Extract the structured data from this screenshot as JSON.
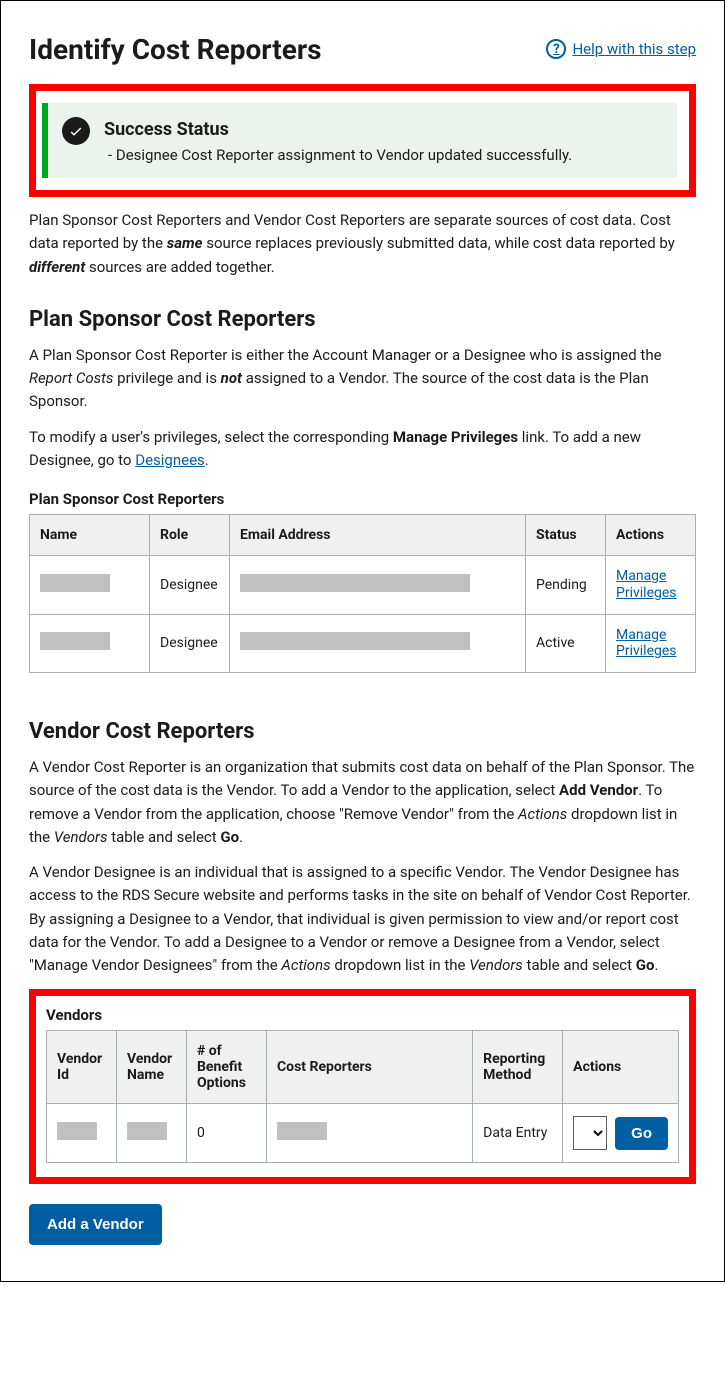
{
  "header": {
    "title": "Identify Cost Reporters",
    "help_label": " Help with this step"
  },
  "alert": {
    "title": "Success Status",
    "message": "Designee Cost Reporter assignment to Vendor updated successfully."
  },
  "intro": {
    "p1a": "Plan Sponsor Cost Reporters and Vendor Cost Reporters are separate sources of cost data. Cost data reported by the ",
    "p1b": "same",
    "p1c": " source replaces previously submitted data, while cost data reported by ",
    "p1d": "different",
    "p1e": " sources are added together."
  },
  "plan_sponsor": {
    "heading": "Plan Sponsor Cost Reporters",
    "p1a": "A Plan Sponsor Cost Reporter is either the Account Manager or a Designee who is assigned the ",
    "p1b": "Report Costs",
    "p1c": " privilege and is ",
    "p1d": "not",
    "p1e": " assigned to a Vendor. The source of the cost data is the Plan Sponsor.",
    "p2a": "To modify a user's privileges, select the corresponding ",
    "p2b": "Manage Privileges",
    "p2c": " link. To add a new Designee, go to ",
    "p2d": "Designees",
    "p2e": ".",
    "table_caption": "Plan Sponsor Cost Reporters",
    "headers": {
      "name": "Name",
      "role": "Role",
      "email": "Email Address",
      "status": "Status",
      "actions": "Actions"
    },
    "rows": [
      {
        "role": "Designee",
        "status": "Pending",
        "action": "Manage Privileges"
      },
      {
        "role": "Designee",
        "status": "Active",
        "action": "Manage Privileges"
      }
    ]
  },
  "vendor": {
    "heading": "Vendor Cost Reporters",
    "p1a": "A Vendor Cost Reporter is an organization that submits cost data on behalf of the Plan Sponsor. The source of the cost data is the Vendor. To add a Vendor to the application, select ",
    "p1b": "Add Vendor",
    "p1c": ". To remove a Vendor from the application, choose \"Remove Vendor\" from the ",
    "p1d": "Actions",
    "p1e": " dropdown list in the ",
    "p1f": "Vendors",
    "p1g": " table and select ",
    "p1h": "Go",
    "p1i": ".",
    "p2a": "A Vendor Designee is an individual that is assigned to a specific Vendor. The Vendor Designee has access to the RDS Secure website and performs tasks in the site on behalf of Vendor Cost Reporter. By assigning a Designee to a Vendor, that individual is given permission to view and/or report cost data for the Vendor. To add a Designee to a Vendor or remove a Designee from a Vendor, select \"Manage Vendor Designees\" from the ",
    "p2b": "Actions",
    "p2c": " dropdown list in the ",
    "p2d": "Vendors",
    "p2e": " table and select ",
    "p2f": "Go",
    "p2g": ".",
    "table_caption": "Vendors",
    "headers": {
      "id": "Vendor Id",
      "name": "Vendor Name",
      "benefit": "# of Benefit Options",
      "reporters": "Cost Reporters",
      "method": "Reporting Method",
      "actions": "Actions"
    },
    "row": {
      "benefit": "0",
      "method": "Data Entry",
      "go": "Go"
    },
    "add_button": "Add a Vendor"
  }
}
